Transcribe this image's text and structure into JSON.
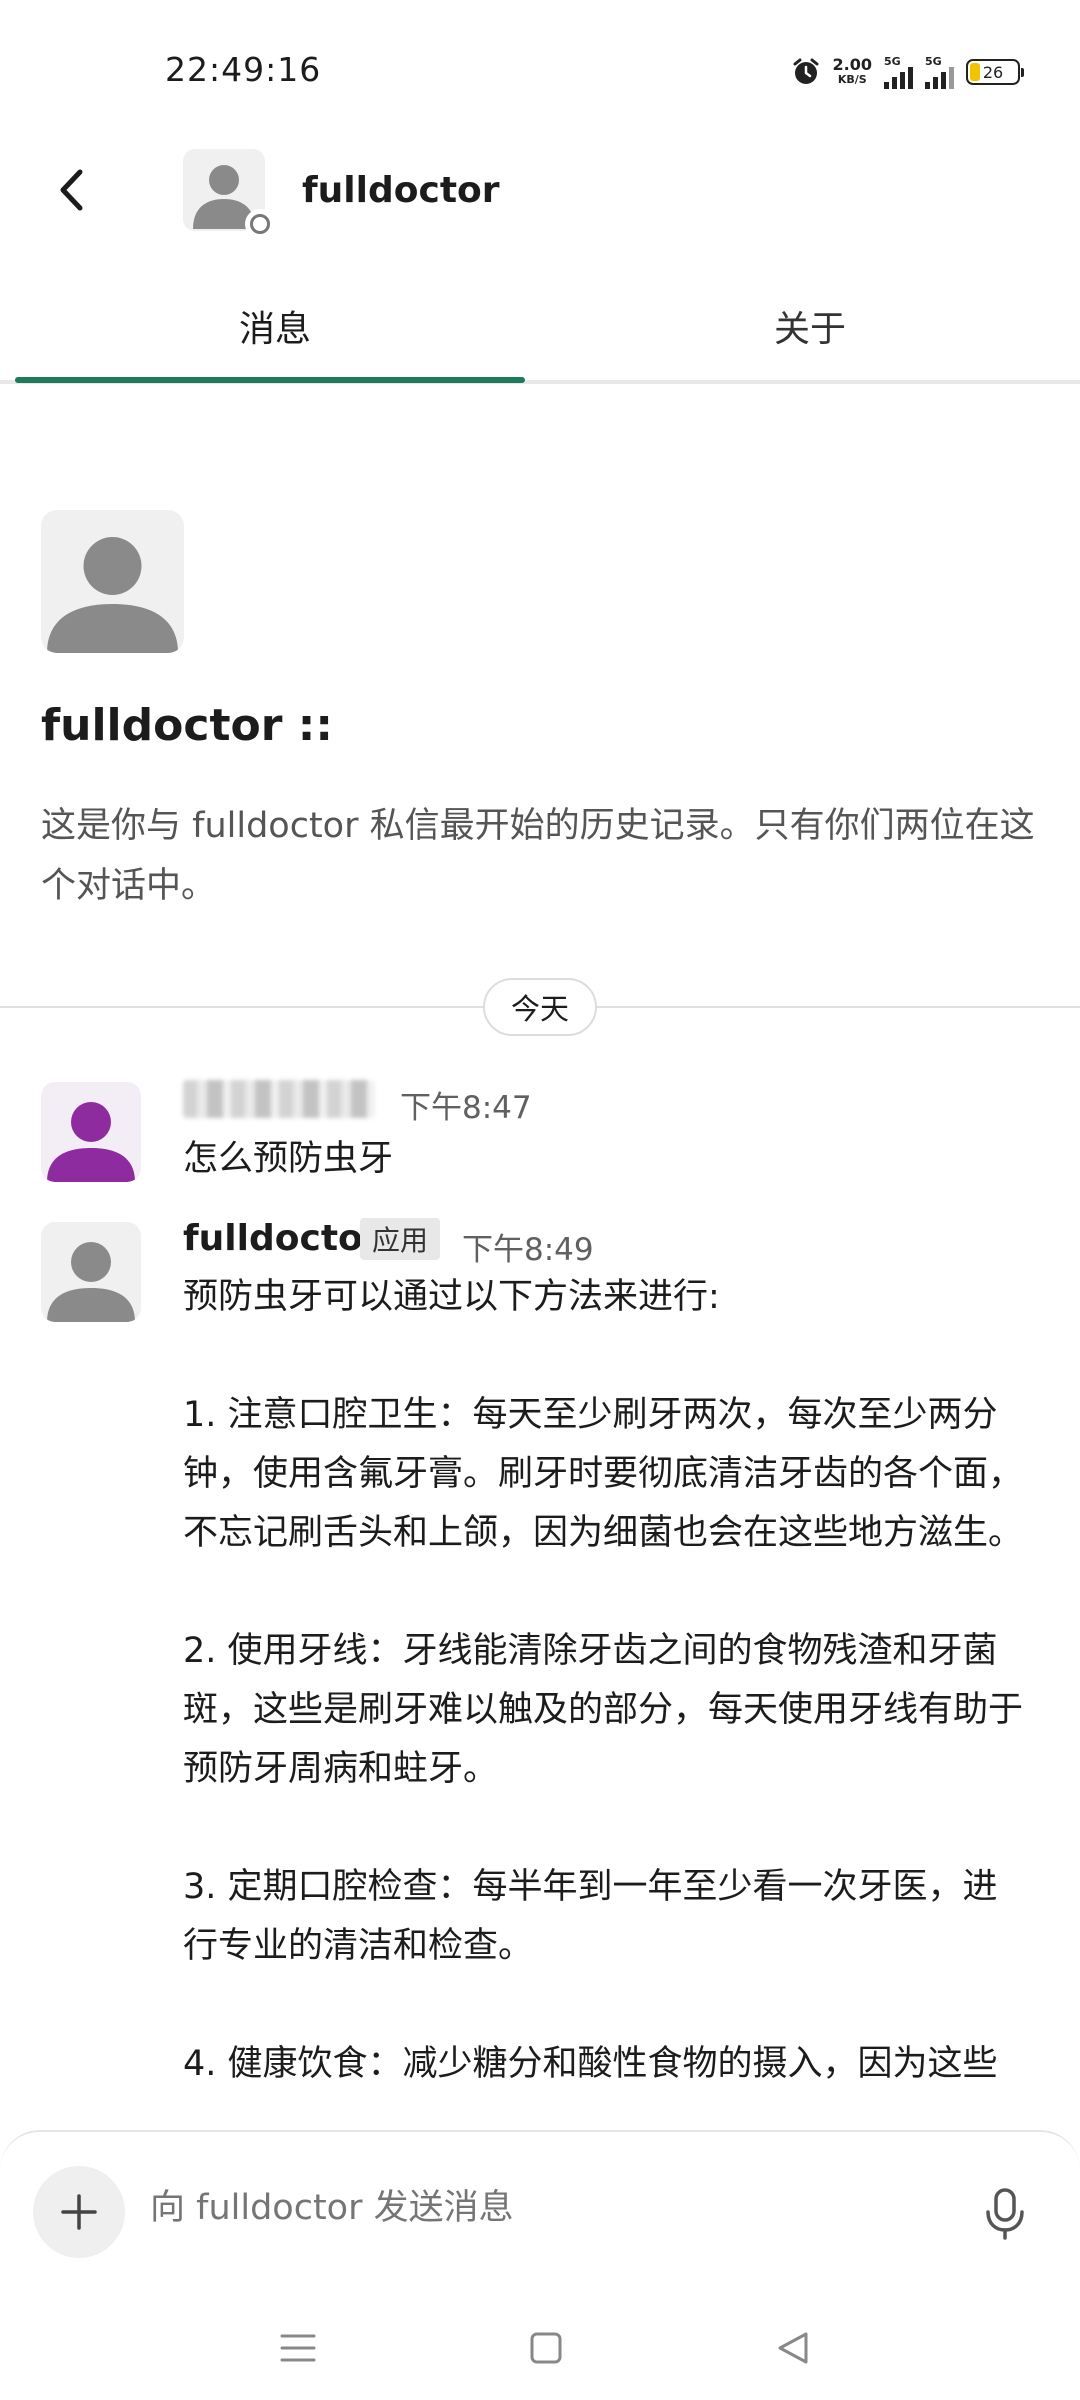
{
  "status_bar": {
    "time": "22:49:16",
    "net_speed": "2.00",
    "net_unit": "KB/S",
    "sim1": "5G",
    "sim2": "5G",
    "battery": "26",
    "icons": [
      "alarm-icon",
      "signal-icon",
      "battery-icon"
    ]
  },
  "header": {
    "title": "fulldoctor",
    "back_icon": "chevron-left-icon"
  },
  "tabs": [
    {
      "label": "消息",
      "active": true
    },
    {
      "label": "关于",
      "active": false
    }
  ],
  "intro": {
    "name": "fulldoctor ::",
    "text": "这是你与 fulldoctor 私信最开始的历史记录。只有你们两位在这个对话中。"
  },
  "day_divider": "今天",
  "messages": [
    {
      "author": "",
      "time": "下午8:47",
      "text": "怎么预防虫牙"
    },
    {
      "author": "fulldoctor",
      "badge": "应用",
      "time": "下午8:49",
      "lines": [
        "预防虫牙可以通过以下方法来进行:",
        "",
        "1. 注意口腔卫生：每天至少刷牙两次，每次至少两分钟，使用含氟牙膏。刷牙时要彻底清洁牙齿的各个面，不忘记刷舌头和上颌，因为细菌也会在这些地方滋生。",
        "",
        "2. 使用牙线：牙线能清除牙齿之间的食物残渣和牙菌斑，这些是刷牙难以触及的部分，每天使用牙线有助于预防牙周病和蛀牙。",
        "",
        "3. 定期口腔检查：每半年到一年至少看一次牙医，进行专业的清洁和检查。",
        "",
        "4. 健康饮食：减少糖分和酸性食物的摄入，因为这些"
      ]
    }
  ],
  "composer": {
    "placeholder": "向 fulldoctor 发送消息"
  },
  "colors": {
    "accent": "#1f7a5a",
    "user_avatar": "#8e2c9f",
    "default_avatar": "#8a8a8a"
  }
}
